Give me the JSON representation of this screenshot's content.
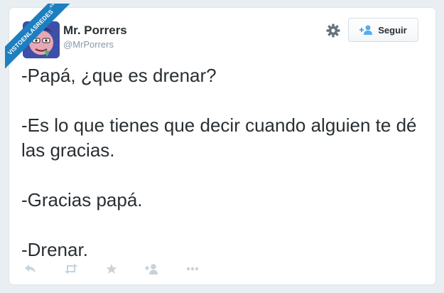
{
  "watermark": {
    "text": "VISTOENLASREDES",
    "suffix": ".com"
  },
  "user": {
    "name": "Mr. Porrers",
    "handle": "@MrPorrers"
  },
  "header": {
    "settings_icon": "gear-icon",
    "follow_label": "Seguir",
    "follow_icon": "add-person-icon"
  },
  "tweet": {
    "lines": [
      "-Papá, ¿que es drenar?",
      "-Es lo que tienes que decir cuando alguien te dé las gracias.",
      "-Gracias papá.",
      "-Drenar."
    ]
  },
  "actions": [
    {
      "icon": "reply-icon"
    },
    {
      "icon": "retweet-icon"
    },
    {
      "icon": "favorite-star-icon"
    },
    {
      "icon": "follow-icon"
    },
    {
      "icon": "more-dots-icon"
    }
  ],
  "colors": {
    "background": "#e9eef2",
    "text": "#292f33",
    "muted": "#8899a6",
    "banner": "#1d7fc0",
    "action_icons": "#c8d2da"
  }
}
